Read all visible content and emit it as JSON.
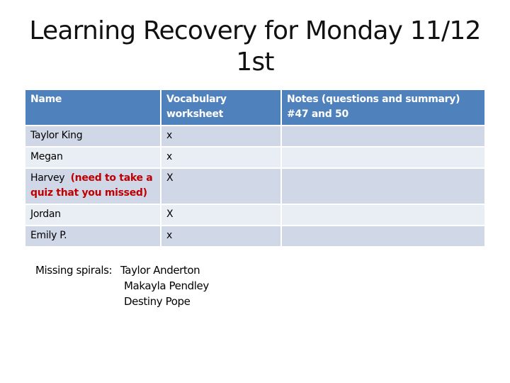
{
  "slide": {
    "title_line1": "Learning Recovery for Monday 11/12",
    "title_line2": "1st"
  },
  "table": {
    "headers": [
      "Name",
      "Vocabulary worksheet",
      "Notes (questions and summary) #47 and 50"
    ],
    "rows": [
      {
        "name": "Taylor King",
        "note": "",
        "vocab": "x",
        "notes": ""
      },
      {
        "name": "Megan",
        "note": "",
        "vocab": "x",
        "notes": ""
      },
      {
        "name": "Harvey",
        "note": "(need to take a quiz that you missed)",
        "vocab": "X",
        "notes": ""
      },
      {
        "name": "Jordan",
        "note": "",
        "vocab": "X",
        "notes": ""
      },
      {
        "name": "Emily P.",
        "note": "",
        "vocab": "x",
        "notes": ""
      }
    ]
  },
  "missing_spirals": {
    "label": "Missing spirals:",
    "names": [
      "Taylor Anderton",
      "Makayla Pendley",
      "Destiny Pope"
    ]
  },
  "colors": {
    "header_bg": "#4f81bd",
    "row_odd_bg": "#d0d8e8",
    "row_even_bg": "#e9edf4",
    "note_red": "#c00000"
  }
}
